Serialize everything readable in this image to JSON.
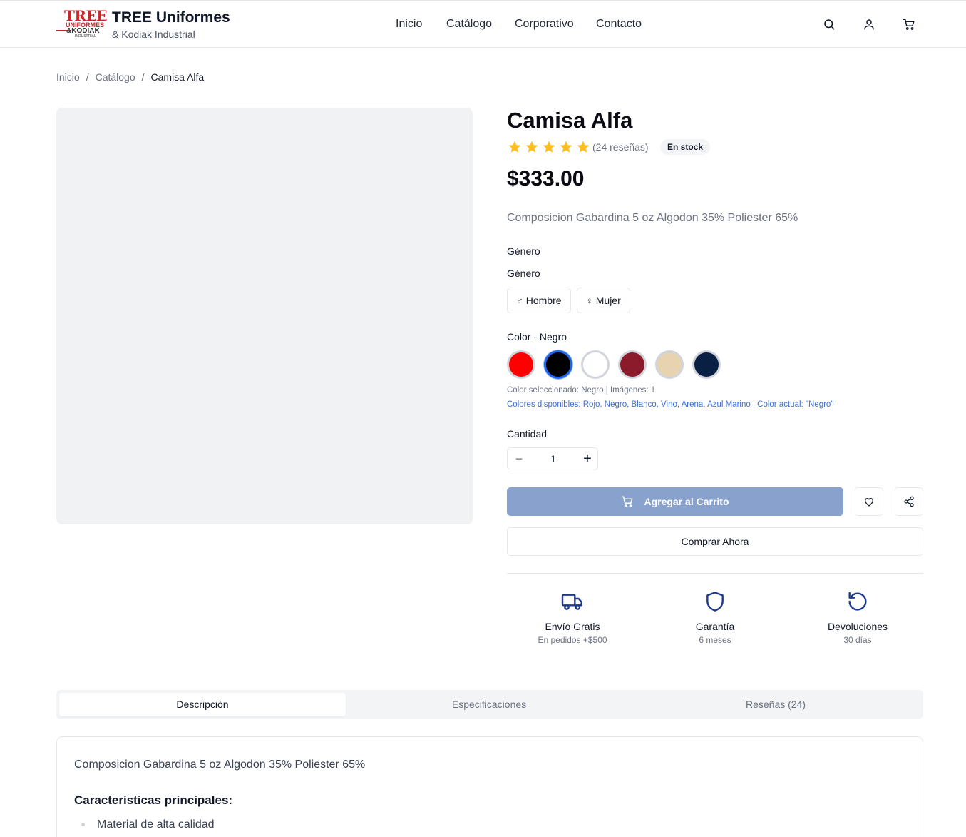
{
  "header": {
    "logo_text_1": "TREE",
    "logo_text_2": "UNIFORMES",
    "logo_text_3": "&KODIAK",
    "logo_text_4": "INDUSTRIAL",
    "brand_name": "TREE Uniformes",
    "brand_sub": "& Kodiak Industrial",
    "nav": [
      "Inicio",
      "Catálogo",
      "Corporativo",
      "Contacto"
    ],
    "icons": [
      "search-icon",
      "user-icon",
      "cart-icon"
    ]
  },
  "breadcrumb": [
    "Inicio",
    "Catálogo",
    "Camisa Alfa"
  ],
  "product": {
    "title": "Camisa Alfa",
    "rating": 5,
    "reviews_label": "(24 reseñas)",
    "stock_label": "En stock",
    "price": "$333.00",
    "short_description": "Composicion Gabardina 5 oz Algodon 35% Poliester 65%",
    "gender_heading": "Género",
    "gender_label": "Género",
    "gender_options": [
      {
        "symbol": "♂",
        "label": "Hombre"
      },
      {
        "symbol": "♀",
        "label": "Mujer"
      }
    ],
    "color_label": "Color - Negro",
    "colors": [
      {
        "name": "Rojo",
        "hex": "#ff0000"
      },
      {
        "name": "Negro",
        "hex": "#000000"
      },
      {
        "name": "Blanco",
        "hex": "#ffffff"
      },
      {
        "name": "Vino",
        "hex": "#8b1a2b"
      },
      {
        "name": "Arena",
        "hex": "#e8d3b0"
      },
      {
        "name": "Azul Marino",
        "hex": "#0a1f44"
      }
    ],
    "selected_color_index": 1,
    "color_info": "Color seleccionado: Negro | Imágenes: 1",
    "colors_available": "Colores disponibles: Rojo, Negro, Blanco, Vino, Arena, Azul Marino | Color actual: \"Negro\"",
    "quantity_label": "Cantidad",
    "quantity": "1",
    "add_to_cart": "Agregar al Carrito",
    "buy_now": "Comprar Ahora"
  },
  "features": [
    {
      "icon": "truck-icon",
      "title": "Envío Gratis",
      "sub": "En pedidos +$500"
    },
    {
      "icon": "shield-icon",
      "title": "Garantía",
      "sub": "6 meses"
    },
    {
      "icon": "return-icon",
      "title": "Devoluciones",
      "sub": "30 días"
    }
  ],
  "tabs": [
    "Descripción",
    "Especificaciones",
    "Reseñas (24)"
  ],
  "active_tab": 0,
  "description": {
    "text": "Composicion Gabardina 5 oz Algodon 35% Poliester 65%",
    "heading": "Características principales:",
    "items": [
      "Material de alta calidad"
    ]
  },
  "colors_theme": {
    "accent": "#2563eb",
    "feature_icon": "#1e3a8a",
    "star": "#fbbf24",
    "add_cart_bg": "#89a2cd"
  }
}
